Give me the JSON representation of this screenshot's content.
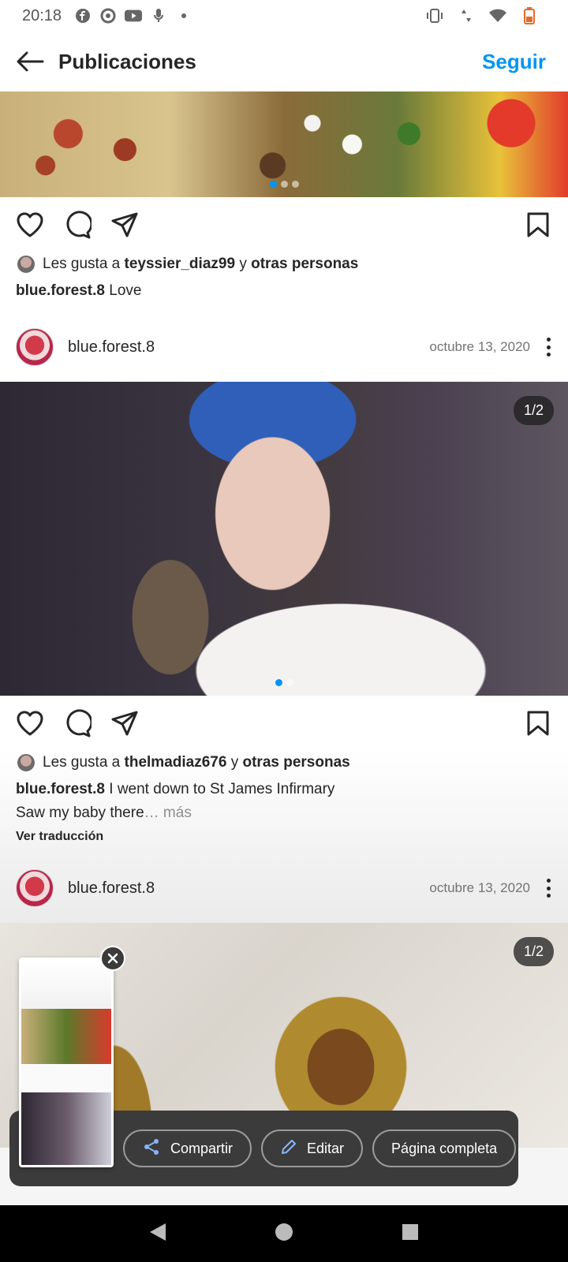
{
  "status_bar": {
    "time": "20:18"
  },
  "header": {
    "title": "Publicaciones",
    "follow_label": "Seguir"
  },
  "posts": [
    {
      "likes_prefix": "Les gusta a ",
      "likes_user": "teyssier_diaz99",
      "likes_join": " y ",
      "likes_others": "otras personas",
      "caption_user": "blue.forest.8",
      "caption_text": " Love"
    },
    {
      "username": "blue.forest.8",
      "date": "octubre 13, 2020",
      "counter": "1/2",
      "likes_prefix": "Les gusta a ",
      "likes_user": "thelmadiaz676",
      "likes_join": " y ",
      "likes_others": "otras personas",
      "caption_user": "blue.forest.8",
      "caption_line1": " I went down to St James Infirmary",
      "caption_line2": "Saw my baby there",
      "more": "… más",
      "translate": "Ver traducción"
    },
    {
      "username": "blue.forest.8",
      "date": "octubre 13, 2020",
      "counter": "1/2"
    }
  ],
  "screenshot_toolbar": {
    "share_label": "Compartir",
    "edit_label": "Editar",
    "full_page_label": "Página completa"
  },
  "colors": {
    "accent": "#0095f6",
    "text": "#262626",
    "muted": "#737373"
  }
}
